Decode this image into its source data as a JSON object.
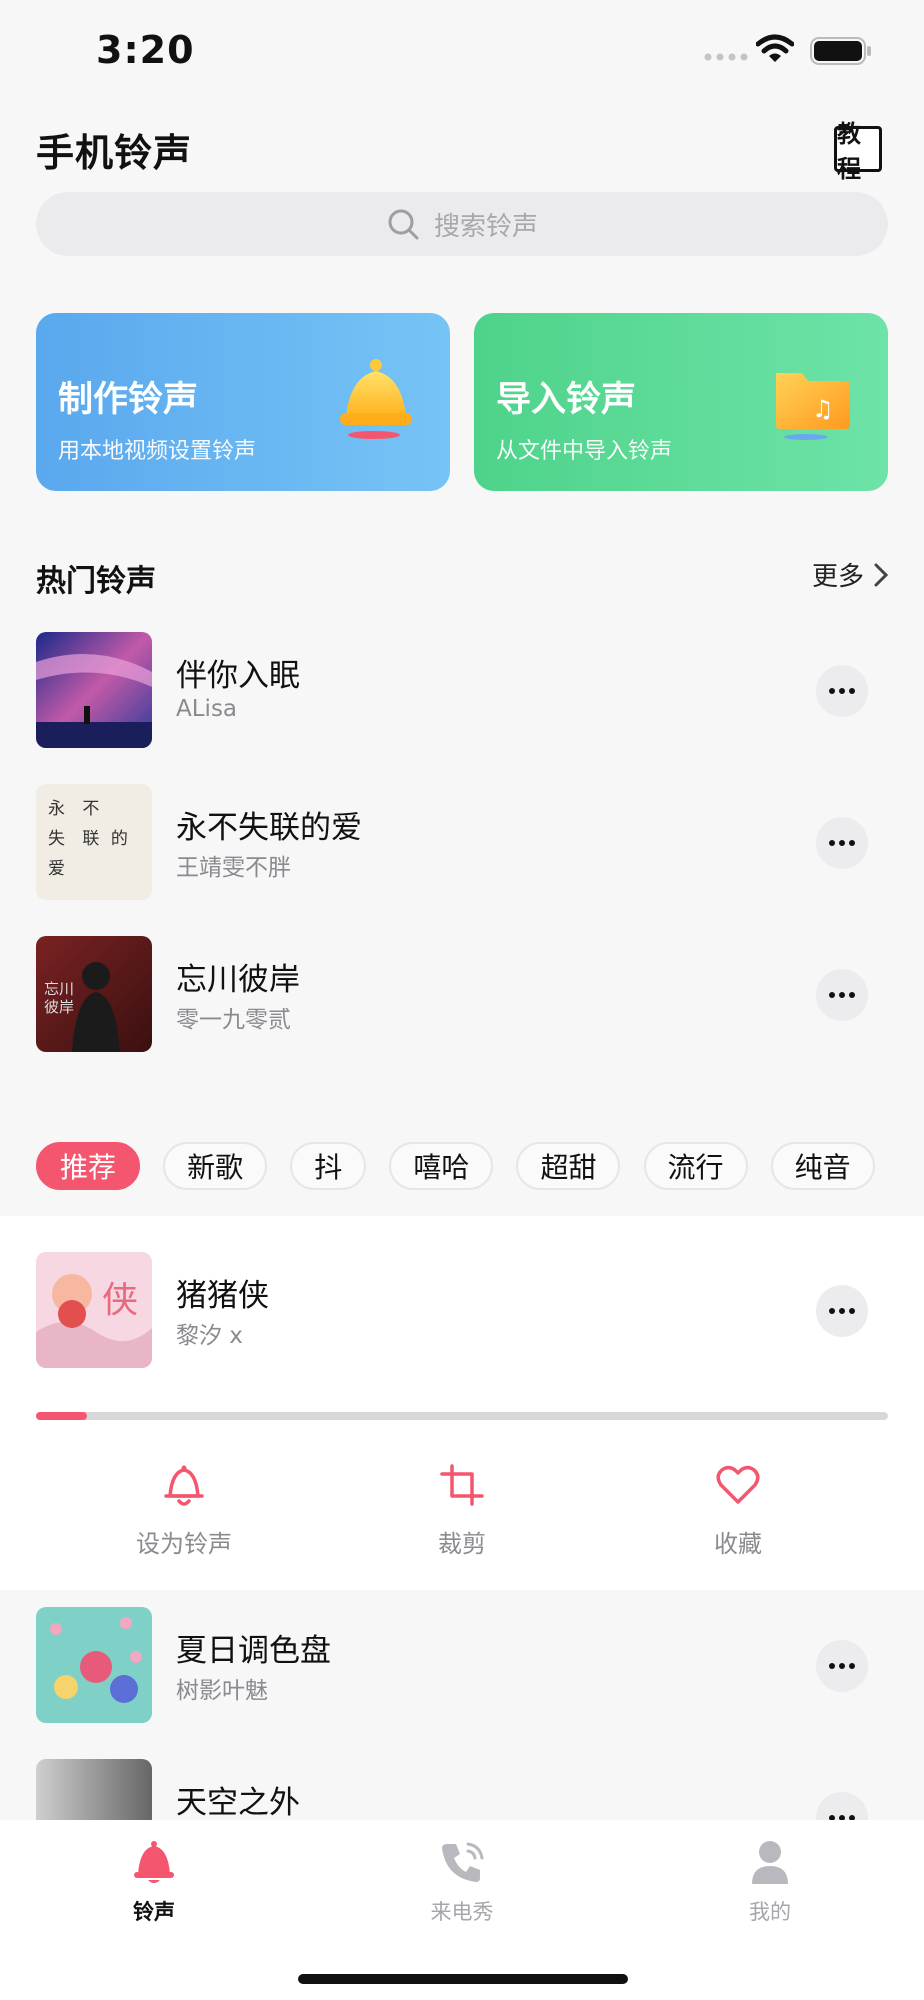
{
  "status_bar": {
    "time": "3:20"
  },
  "header": {
    "title": "手机铃声",
    "tutorial_label": "教程"
  },
  "search": {
    "placeholder": "搜索铃声"
  },
  "cards": {
    "make": {
      "title": "制作铃声",
      "subtitle": "用本地视频设置铃声"
    },
    "import": {
      "title": "导入铃声",
      "subtitle": "从文件中导入铃声"
    }
  },
  "hot": {
    "title": "热门铃声",
    "more_label": "更多",
    "songs": [
      {
        "title": "伴你入眠",
        "artist": "ALisa"
      },
      {
        "title": "永不失联的爱",
        "artist": "王靖雯不胖",
        "cover_text": [
          "永",
          "不",
          "失",
          "联",
          "的",
          "爱"
        ]
      },
      {
        "title": "忘川彼岸",
        "artist": "零一九零贰",
        "cover_text": "忘川彼岸"
      }
    ]
  },
  "categories": [
    "推荐",
    "新歌",
    "抖",
    "嘻哈",
    "超甜",
    "流行",
    "纯音"
  ],
  "active_category": "推荐",
  "now_playing": {
    "title": "猪猪侠",
    "artist": "黎汐 x",
    "progress": 0.06,
    "actions": [
      {
        "label": "设为铃声",
        "icon": "bell-outline-icon"
      },
      {
        "label": "裁剪",
        "icon": "crop-icon"
      },
      {
        "label": "收藏",
        "icon": "heart-outline-icon"
      }
    ]
  },
  "list": [
    {
      "title": "夏日调色盘",
      "artist": "树影叶魅"
    },
    {
      "title": "天空之外",
      "artist": ""
    }
  ],
  "tabbar": {
    "items": [
      {
        "label": "铃声",
        "icon": "bell-icon",
        "active": true
      },
      {
        "label": "来电秀",
        "icon": "phone-icon",
        "active": false
      },
      {
        "label": "我的",
        "icon": "person-icon",
        "active": false
      }
    ]
  },
  "colors": {
    "accent": "#f4566f",
    "card_blue": "#5aa8ee",
    "card_green": "#4ed38a"
  }
}
